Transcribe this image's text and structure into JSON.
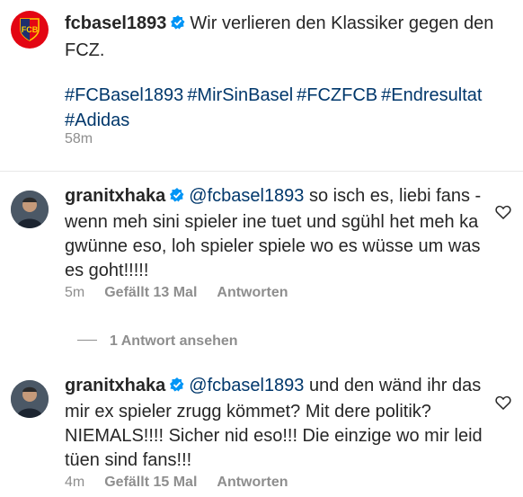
{
  "caption": {
    "username": "fcbasel1893",
    "text": "Wir verlieren den Klassiker gegen den FCZ.",
    "hashtags": [
      "#FCBasel1893",
      "#MirSinBasel",
      "#FCZFCB",
      "#Endresultat",
      "#Adidas"
    ],
    "time": "58m"
  },
  "comments": [
    {
      "username": "granitxhaka",
      "mention": "@fcbasel1893",
      "text": "so isch es, liebi fans - wenn meh sini spieler ine tuet und sgühl het meh ka gwünne eso, loh spieler spiele wo es wüsse um was es goht!!!!!",
      "time": "5m",
      "likes": "Gefällt 13 Mal",
      "reply": "Antworten"
    },
    {
      "username": "granitxhaka",
      "mention": "@fcbasel1893",
      "text": "und den wänd ihr das mir ex spieler zrugg kömmet? Mit dere politik? NIEMALS!!!! Sicher nid eso!!! Die einzige wo mir leid tüen sind fans!!!",
      "time": "4m",
      "likes": "Gefällt 15 Mal",
      "reply": "Antworten"
    }
  ],
  "view_replies": "1 Antwort ansehen",
  "colors": {
    "link": "#00376b",
    "muted": "#8e8e8e",
    "verified": "#0095f6",
    "club_red": "#e30613",
    "club_blue": "#1e2f6e"
  }
}
